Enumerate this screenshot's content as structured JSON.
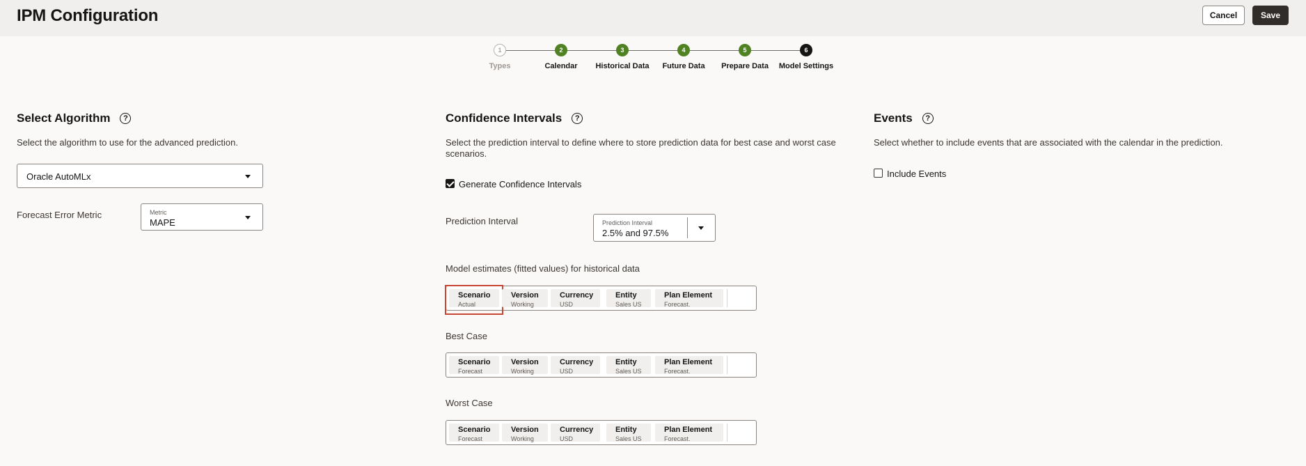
{
  "header": {
    "title": "IPM Configuration",
    "cancel_label": "Cancel",
    "save_label": "Save"
  },
  "steps": [
    {
      "num": "1",
      "label": "Types",
      "state": "todo"
    },
    {
      "num": "2",
      "label": "Calendar",
      "state": "done"
    },
    {
      "num": "3",
      "label": "Historical Data",
      "state": "done"
    },
    {
      "num": "4",
      "label": "Future Data",
      "state": "done"
    },
    {
      "num": "5",
      "label": "Prepare Data",
      "state": "done"
    },
    {
      "num": "6",
      "label": "Model Settings",
      "state": "current"
    }
  ],
  "algorithm": {
    "title": "Select Algorithm",
    "description": "Select the algorithm to use for the advanced prediction.",
    "selected": "Oracle AutoMLx",
    "error_metric_label": "Forecast Error Metric",
    "metric_field_label": "Metric",
    "metric_value": "MAPE"
  },
  "confidence": {
    "title": "Confidence Intervals",
    "description_line1": "Select the prediction interval to define where to store prediction data for best case and worst case",
    "description_line2": "scenarios.",
    "generate_label": "Generate Confidence Intervals",
    "generate_checked": true,
    "prediction_interval_label": "Prediction Interval",
    "pi_field_label": "Prediction Interval",
    "pi_value": "2.5% and 97.5%",
    "model_estimates_label": "Model estimates (fitted values) for historical data",
    "best_case_label": "Best Case",
    "worst_case_label": "Worst Case",
    "model_estimates_pov": [
      {
        "name": "Scenario",
        "value": "Actual"
      },
      {
        "name": "Version",
        "value": "Working"
      },
      {
        "name": "Currency",
        "value": "USD"
      },
      {
        "name": "Entity",
        "value": "Sales US"
      },
      {
        "name": "Plan Element",
        "value": "Forecast."
      }
    ],
    "best_case_pov": [
      {
        "name": "Scenario",
        "value": "Forecast"
      },
      {
        "name": "Version",
        "value": "Working"
      },
      {
        "name": "Currency",
        "value": "USD"
      },
      {
        "name": "Entity",
        "value": "Sales US"
      },
      {
        "name": "Plan Element",
        "value": "Forecast."
      }
    ],
    "worst_case_pov": [
      {
        "name": "Scenario",
        "value": "Forecast"
      },
      {
        "name": "Version",
        "value": "Working"
      },
      {
        "name": "Currency",
        "value": "USD"
      },
      {
        "name": "Entity",
        "value": "Sales US"
      },
      {
        "name": "Plan Element",
        "value": "Forecast."
      }
    ]
  },
  "events": {
    "title": "Events",
    "description": "Select whether to include events that are associated with the calendar in the prediction.",
    "include_label": "Include Events",
    "include_checked": false
  },
  "colors": {
    "step_done": "#508223",
    "step_current": "#161513",
    "focus_outline": "#c74634",
    "save_button": "#312d2a"
  }
}
